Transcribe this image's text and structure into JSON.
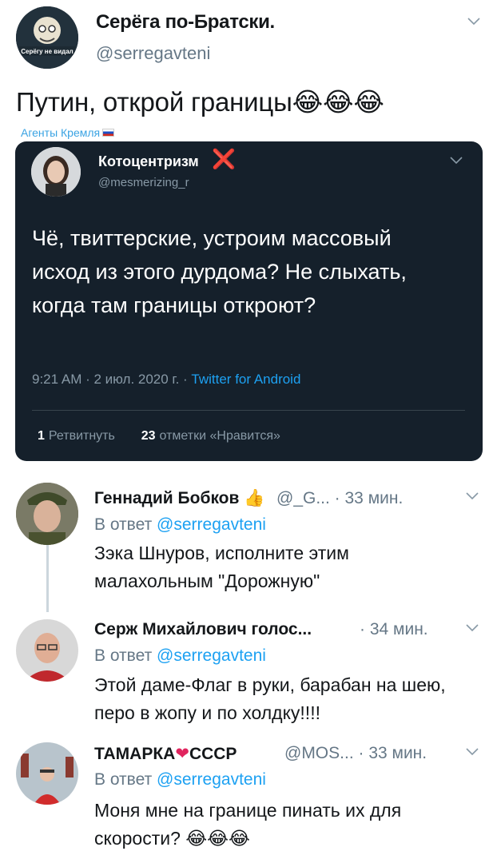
{
  "main_tweet": {
    "author_name": "Серёга по-Братски.",
    "author_handle": "@serregavteni",
    "text": "Путин, открой границы",
    "text_emoji": "😂😂😂",
    "label": "Агенты Кремля",
    "avatar_text": "Серёгу не видал"
  },
  "quoted_tweet": {
    "author_name": "Котоцентризм",
    "verified_mark": "❌",
    "author_handle": "@mesmerizing_r",
    "text": "Чё, твиттерские, устроим массовый исход из этого дурдома? Не слыхать, когда там границы откроют?",
    "timestamp": "9:21 AM · 2 июл. 2020 г. · ",
    "source": "Twitter for Android",
    "retweets_count": "1",
    "retweets_label": "Ретвитнуть",
    "likes_count": "23",
    "likes_label": "отметки «Нравится»"
  },
  "replies": [
    {
      "name": "Геннадий Бобков",
      "name_emoji": "👍",
      "handle_time": "@_G... · 33 мин.",
      "reply_prefix": "В ответ ",
      "reply_to": "@serregavteni",
      "text": "Зэка Шнуров, исполните этим малахольным \"Дорожную\""
    },
    {
      "name": "Серж Михайлович голос...",
      "handle_time": "· 34 мин.",
      "reply_prefix": "В ответ ",
      "reply_to": "@serregavteni",
      "text": "Этой даме-Флаг в руки, барабан на шею, перо в жопу и по холдку!!!!"
    },
    {
      "name_part1": "ТАМАРКА",
      "name_heart": "❤",
      "name_part2": "СССР",
      "handle_time": "@MOS... · 33 мин.",
      "reply_prefix": "В ответ ",
      "reply_to": "@serregavteni",
      "text": "Моня мне на границе пинать их для скорости? ",
      "text_emoji": "😂😂😂"
    }
  ],
  "colors": {
    "link_blue": "#1da1f2",
    "card_bg": "#15202b",
    "muted_gray": "#657786",
    "cross_red": "#e0245e"
  },
  "icons": [
    "chevron-down-icon",
    "thumbs-up-icon",
    "heart-icon",
    "cross-mark-icon",
    "russia-flag-icon"
  ]
}
